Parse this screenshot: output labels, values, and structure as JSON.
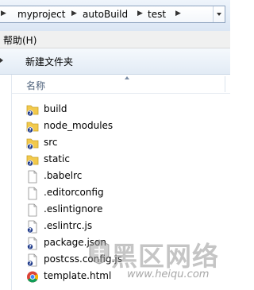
{
  "address": {
    "crumbs": [
      "myproject",
      "autoBuild",
      "test"
    ]
  },
  "menu": {
    "help": "帮助(H)"
  },
  "toolbar": {
    "new_folder": "新建文件夹"
  },
  "list": {
    "column_name": "名称",
    "items": [
      {
        "name": "build",
        "icon": "folder-icon"
      },
      {
        "name": "node_modules",
        "icon": "folder-icon"
      },
      {
        "name": "src",
        "icon": "folder-icon"
      },
      {
        "name": "static",
        "icon": "folder-icon"
      },
      {
        "name": ".babelrc",
        "icon": "file-icon"
      },
      {
        "name": ".editorconfig",
        "icon": "file-icon"
      },
      {
        "name": ".eslintignore",
        "icon": "file-icon"
      },
      {
        "name": ".eslintrc.js",
        "icon": "file-icon"
      },
      {
        "name": "package.json",
        "icon": "file-icon"
      },
      {
        "name": "postcss.config.js",
        "icon": "file-icon"
      },
      {
        "name": "template.html",
        "icon": "chrome-icon"
      }
    ]
  },
  "watermark": {
    "title": "黑区网络",
    "url": "www.heiqu.com"
  },
  "colors": {
    "folder": "#f2c94c",
    "badge": "#1e3a8a",
    "header_text": "#4c607a"
  }
}
